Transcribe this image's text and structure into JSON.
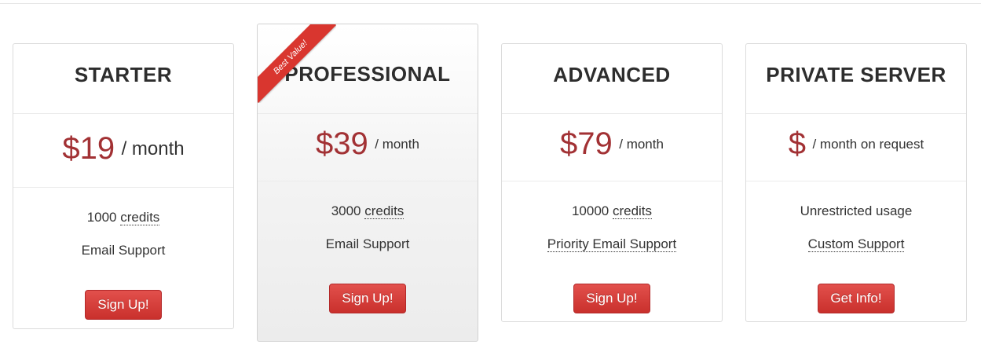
{
  "plans": [
    {
      "name": "STARTER",
      "price": "$19",
      "period": "/ month",
      "features": [
        {
          "pre": "1000 ",
          "dotted": "credits"
        },
        {
          "pre": "Email Support",
          "dotted": ""
        }
      ],
      "button": "Sign Up!"
    },
    {
      "name": "PROFESSIONAL",
      "ribbon": "Best Value!",
      "price": "$39",
      "period": "/ month",
      "features": [
        {
          "pre": "3000 ",
          "dotted": "credits"
        },
        {
          "pre": "Email Support",
          "dotted": ""
        }
      ],
      "button": "Sign Up!"
    },
    {
      "name": "ADVANCED",
      "price": "$79",
      "period": "/ month",
      "features": [
        {
          "pre": "10000 ",
          "dotted": "credits"
        },
        {
          "pre": "",
          "dotted": "Priority Email Support"
        }
      ],
      "button": "Sign Up!"
    },
    {
      "name": "PRIVATE SERVER",
      "price": "$",
      "period": "/ month on request",
      "features": [
        {
          "pre": "Unrestricted usage",
          "dotted": ""
        },
        {
          "pre": "",
          "dotted": "Custom Support"
        }
      ],
      "button": "Get Info!"
    }
  ],
  "colors": {
    "price": "#a23134",
    "button": "#d43f3a",
    "ribbon": "#d9362f"
  }
}
